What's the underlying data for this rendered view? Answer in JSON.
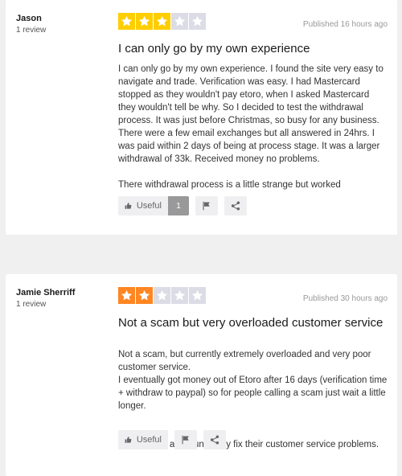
{
  "reviews": [
    {
      "reviewer_name": "Jason",
      "review_count": "1 review",
      "rating": 3,
      "star_color": "#ffce00",
      "published": "Published 16 hours ago",
      "title": "I can only go by my own experience",
      "paragraphs": [
        "I can only go by my own experience. I found the site very easy to navigate and trade. Verification was easy. I had Mastercard stopped as they wouldn't pay etoro, when I asked Mastercard they wouldn't tell be why. So I decided to test the withdrawal process. It was just before Christmas, so busy for any business. There were a few email exchanges but all answered in 24hrs. I was paid within 2 days of being at process stage. It was a larger withdrawal of 33k. Received money no problems.",
        "There withdrawal process is a little strange but worked"
      ],
      "useful_label": "Useful",
      "useful_count": "1",
      "flag_icon": "flag-icon",
      "share_icon": "share-icon"
    },
    {
      "reviewer_name": "Jamie Sherriff",
      "review_count": "1 review",
      "rating": 2,
      "star_color": "#ff8622",
      "published": "Published 30 hours ago",
      "title": "Not a scam but very overloaded customer service",
      "paragraphs": [
        "Not a scam, but currently extremely overloaded and very poor customer service.\nI eventually got money out of Etoro after 16 days (verification time + withdraw to paypal) so for people calling a scam just wait a little longer.",
        "I would stay away until they fix their customer service problems."
      ],
      "useful_label": "Useful",
      "flag_icon": "flag-icon",
      "share_icon": "share-icon"
    }
  ],
  "empty_star_color": "#dcdce6"
}
